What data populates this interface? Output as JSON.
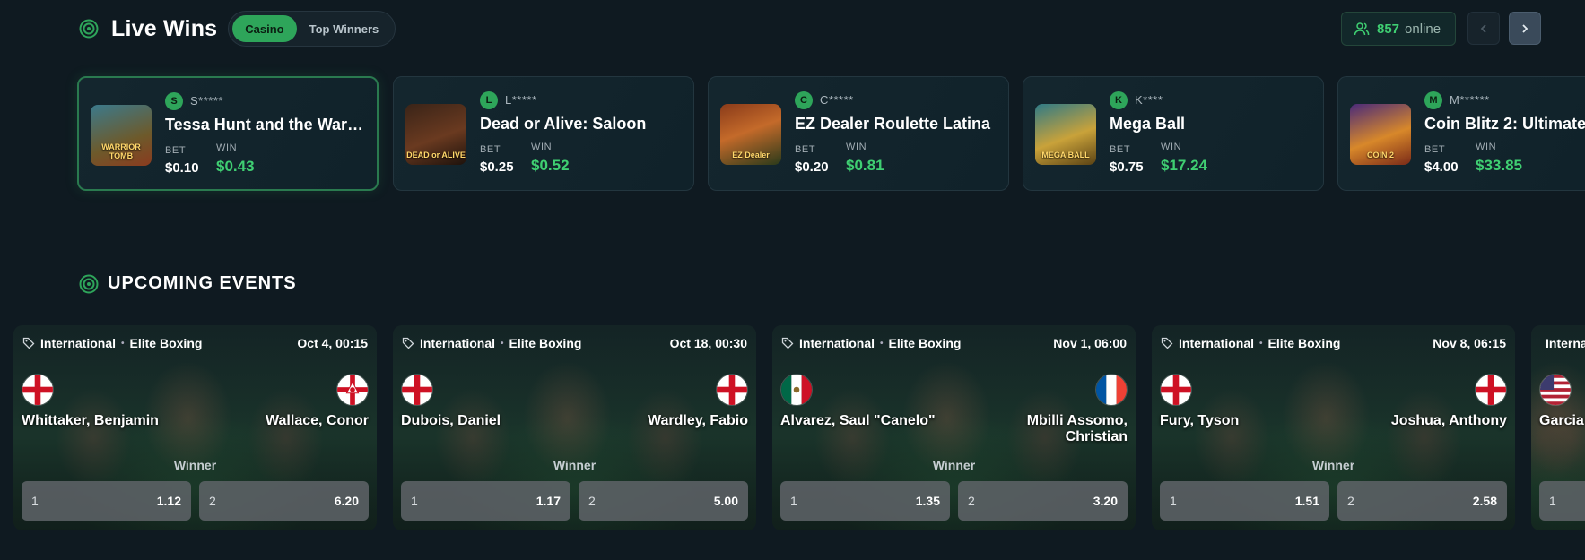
{
  "live_wins": {
    "title": "Live Wins",
    "tabs": [
      {
        "label": "Casino",
        "active": true
      },
      {
        "label": "Top Winners",
        "active": false
      }
    ],
    "online_count": "857",
    "online_label": "online",
    "accent_color": "#2ea55a"
  },
  "wins": [
    {
      "initial": "S",
      "user": "S*****",
      "game": "Tessa Hunt and the Warrior Tomb",
      "thumb_text": "WARRIOR TOMB",
      "bet_label": "BET",
      "bet": "$0.10",
      "win_label": "WIN",
      "win": "$0.43"
    },
    {
      "initial": "L",
      "user": "L*****",
      "game": "Dead or Alive: Saloon",
      "thumb_text": "DEAD or ALIVE",
      "bet_label": "BET",
      "bet": "$0.25",
      "win_label": "WIN",
      "win": "$0.52"
    },
    {
      "initial": "C",
      "user": "C*****",
      "game": "EZ Dealer Roulette Latina",
      "thumb_text": "EZ Dealer",
      "bet_label": "BET",
      "bet": "$0.20",
      "win_label": "WIN",
      "win": "$0.81"
    },
    {
      "initial": "K",
      "user": "K****",
      "game": "Mega Ball",
      "thumb_text": "MEGA BALL",
      "bet_label": "BET",
      "bet": "$0.75",
      "win_label": "WIN",
      "win": "$17.24"
    },
    {
      "initial": "M",
      "user": "M******",
      "game": "Coin Blitz 2: Ultimate",
      "thumb_text": "COIN 2",
      "bet_label": "BET",
      "bet": "$4.00",
      "win_label": "WIN",
      "win": "$33.85"
    }
  ],
  "upcoming": {
    "title": "UPCOMING EVENTS"
  },
  "events": [
    {
      "region": "International",
      "league": "Elite Boxing",
      "date": "Oct 4, 00:15",
      "home": "Whittaker, Benjamin",
      "away": "Wallace, Conor",
      "home_flag": "england",
      "away_flag": "northern-ireland",
      "market": "Winner",
      "sel1": "1",
      "odd1": "1.12",
      "sel2": "2",
      "odd2": "6.20"
    },
    {
      "region": "International",
      "league": "Elite Boxing",
      "date": "Oct 18, 00:30",
      "home": "Dubois, Daniel",
      "away": "Wardley, Fabio",
      "home_flag": "england",
      "away_flag": "england",
      "market": "Winner",
      "sel1": "1",
      "odd1": "1.17",
      "sel2": "2",
      "odd2": "5.00"
    },
    {
      "region": "International",
      "league": "Elite Boxing",
      "date": "Nov 1, 06:00",
      "home": "Alvarez, Saul \"Canelo\"",
      "away": "Mbilli Assomo, Christian",
      "home_flag": "mexico",
      "away_flag": "france",
      "market": "Winner",
      "sel1": "1",
      "odd1": "1.35",
      "sel2": "2",
      "odd2": "3.20"
    },
    {
      "region": "International",
      "league": "Elite Boxing",
      "date": "Nov 8, 06:15",
      "home": "Fury, Tyson",
      "away": "Joshua, Anthony",
      "home_flag": "england",
      "away_flag": "england",
      "market": "Winner",
      "sel1": "1",
      "odd1": "1.51",
      "sel2": "2",
      "odd2": "2.58"
    },
    {
      "region": "International",
      "league": "",
      "date": "",
      "home": "Garcia",
      "away": "",
      "home_flag": "usa",
      "away_flag": "",
      "market": "",
      "sel1": "1",
      "odd1": "",
      "sel2": "",
      "odd2": ""
    }
  ]
}
